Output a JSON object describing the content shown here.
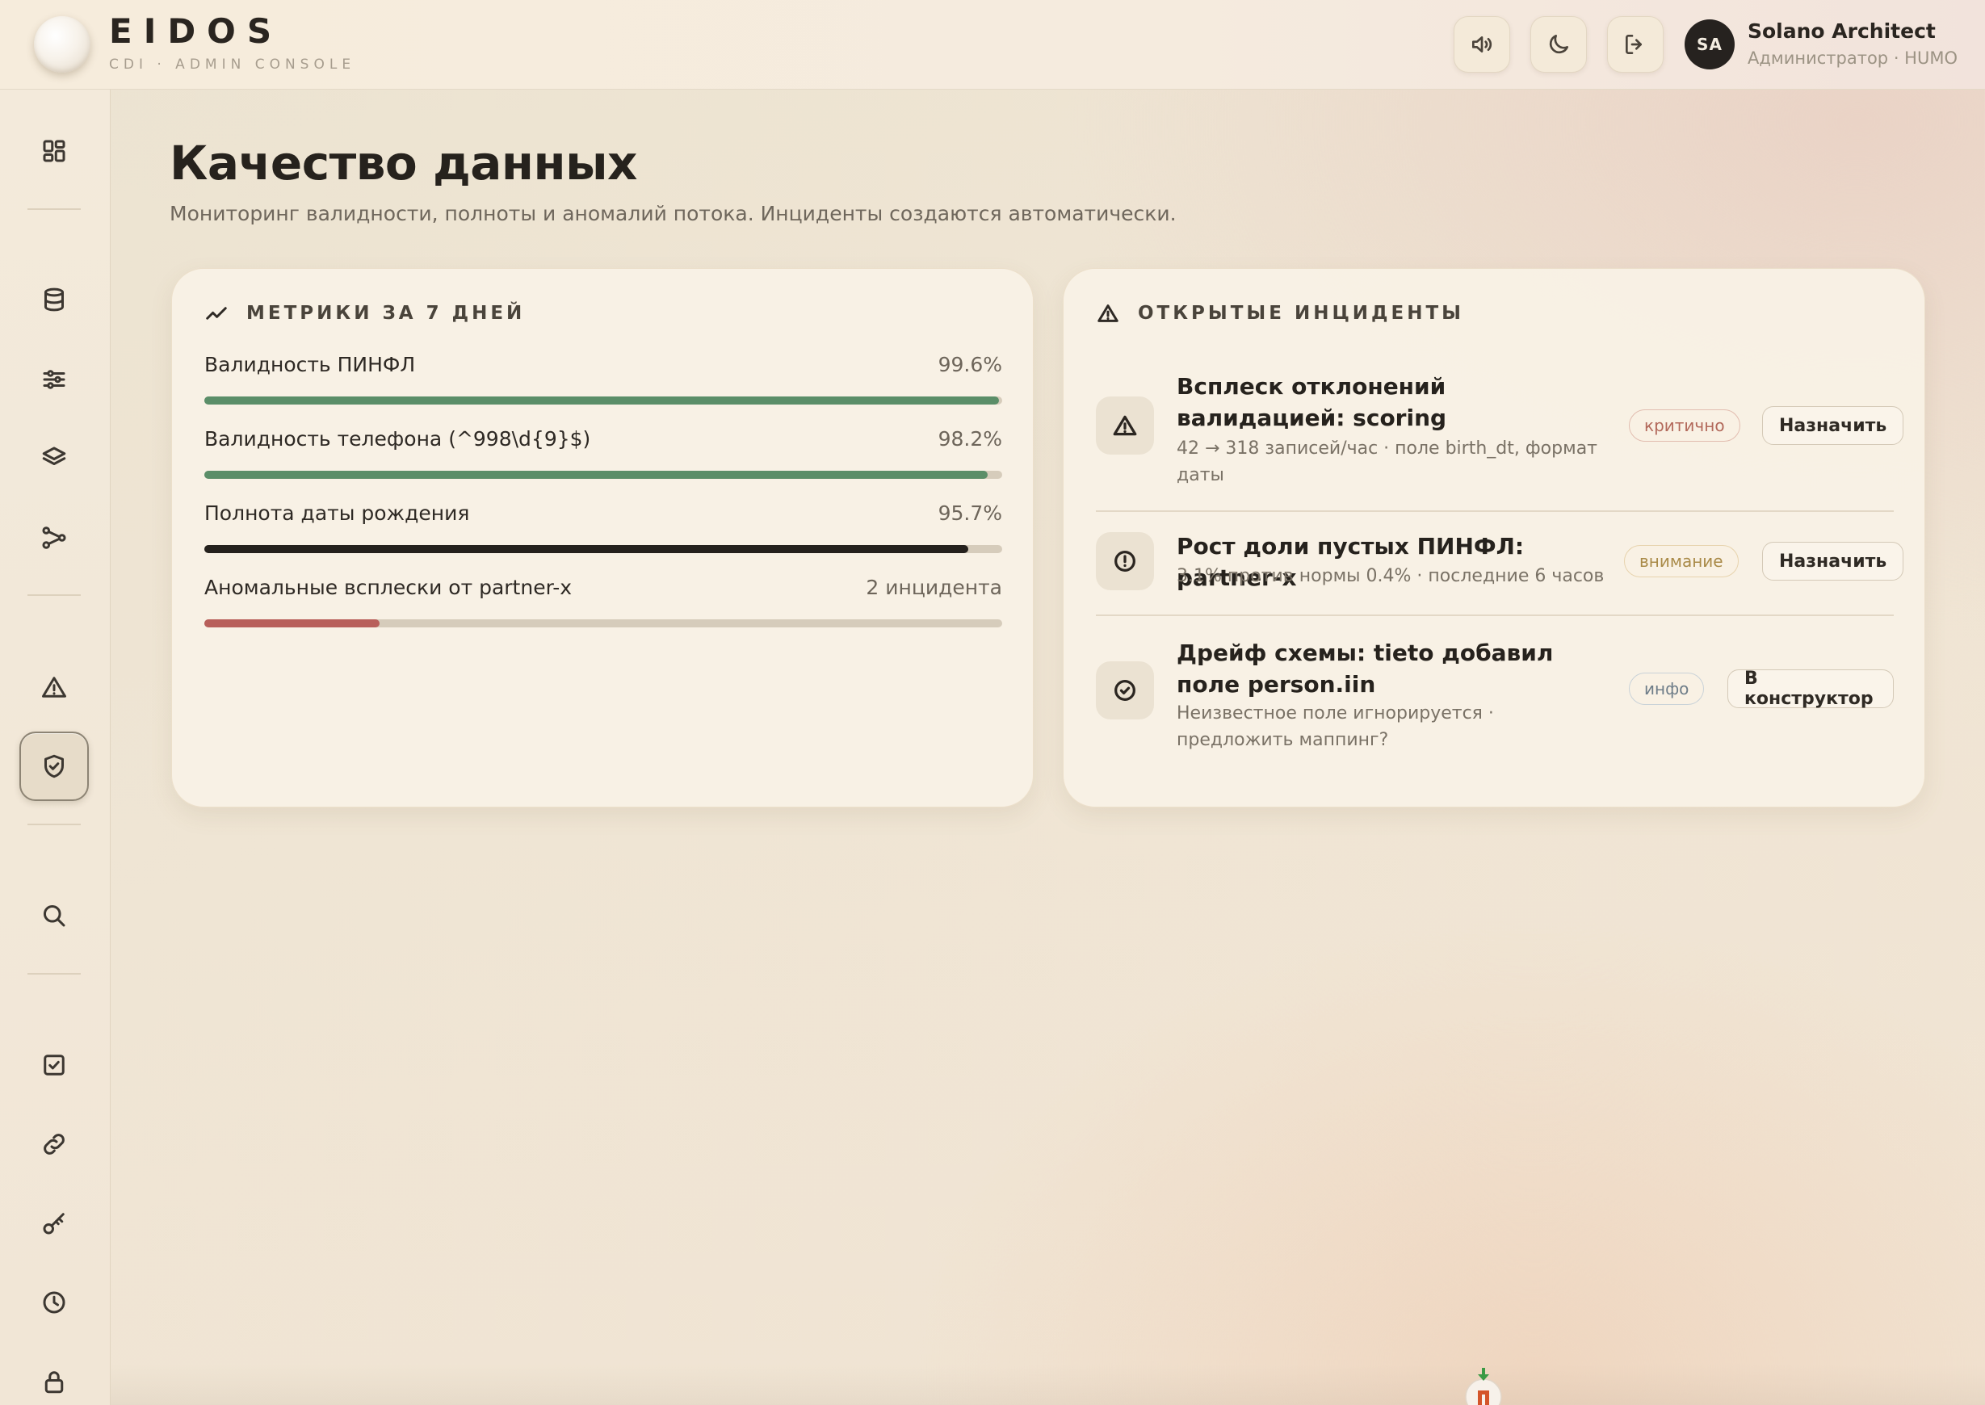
{
  "app": {
    "brand": "EIDOS",
    "brand_sub": "CDI · ADMIN CONSOLE"
  },
  "header": {
    "buttons": [
      "speaker-icon",
      "moon-icon",
      "logout-icon"
    ],
    "user": {
      "initials": "SA",
      "name": "Solano Architect",
      "role": "Администратор · HUMO"
    }
  },
  "sidebar": {
    "items": [
      {
        "icon": "dashboard-icon",
        "active": false
      },
      {
        "icon": "database-icon",
        "active": false
      },
      {
        "icon": "sliders-icon",
        "active": false
      },
      {
        "icon": "layers-icon",
        "active": false
      },
      {
        "icon": "flow-icon",
        "active": false
      },
      {
        "icon": "alert-icon",
        "active": false
      },
      {
        "icon": "shield-check-icon",
        "active": true
      },
      {
        "icon": "search-icon",
        "active": false
      },
      {
        "icon": "checkbox-icon",
        "active": false
      },
      {
        "icon": "link-icon",
        "active": false
      },
      {
        "icon": "key-icon",
        "active": false
      },
      {
        "icon": "clock-icon",
        "active": false
      },
      {
        "icon": "lock-icon",
        "active": false
      }
    ]
  },
  "page": {
    "title": "Качество данных",
    "subtitle": "Мониторинг валидности, полноты и аномалий потока. Инциденты создаются автоматически."
  },
  "metrics": {
    "heading": "МЕТРИКИ ЗА 7 ДНЕЙ",
    "items": [
      {
        "label": "Валидность ПИНФЛ",
        "value": "99.6%",
        "fraction": 0.996,
        "color": "#5b8e68"
      },
      {
        "label": "Валидность телефона (^998\\d{9}$)",
        "value": "98.2%",
        "fraction": 0.982,
        "color": "#5b8e68"
      },
      {
        "label": "Полнота даты рождения",
        "value": "95.7%",
        "fraction": 0.957,
        "color": "#25211d"
      },
      {
        "label": "Аномальные всплески от partner-x",
        "value": "2 инцидента",
        "fraction": 0.22,
        "color": "#b85f5a"
      }
    ]
  },
  "incidents": {
    "heading": "ОТКРЫТЫЕ ИНЦИДЕНТЫ",
    "items": [
      {
        "icon": "warning-triangle-icon",
        "title": "Всплеск отклонений валидацией: scoring",
        "detail": "42 → 318 записей/час · поле birth_dt, формат даты",
        "severity": "критично",
        "action": "Назначить"
      },
      {
        "icon": "clock-alert-icon",
        "title": "Рост доли пустых ПИНФЛ: partner-x",
        "detail": "3.1% против нормы 0.4% · последние 6 часов",
        "severity": "внимание",
        "action": "Назначить"
      },
      {
        "icon": "check-circle-icon",
        "title": "Дрейф схемы: tieto добавил поле person.iin",
        "detail": "Неизвестное поле игнорируется · предложить маппинг?",
        "severity": "инфо",
        "action": "В конструктор"
      }
    ]
  }
}
